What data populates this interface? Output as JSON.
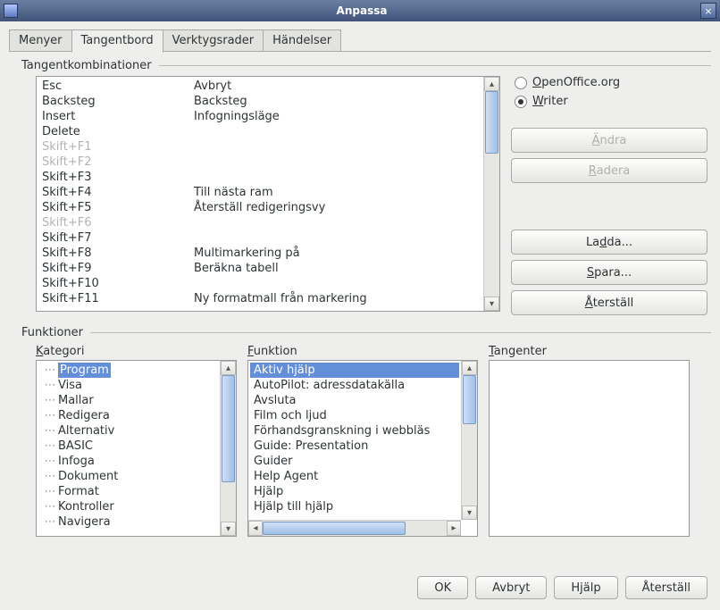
{
  "window": {
    "title": "Anpassa",
    "close_glyph": "×"
  },
  "tabs": {
    "menus": "Menyer",
    "keyboard": "Tangentbord",
    "toolbars": "Verktygsrader",
    "events": "Händelser"
  },
  "sections": {
    "shortcuts": "Tangentkombinationer",
    "functions": "Funktioner"
  },
  "shortcuts": [
    {
      "key": "Esc",
      "action": "Avbryt",
      "disabled": false
    },
    {
      "key": "Backsteg",
      "action": "Backsteg",
      "disabled": false
    },
    {
      "key": "Insert",
      "action": "Infogningsläge",
      "disabled": false
    },
    {
      "key": "Delete",
      "action": "",
      "disabled": false
    },
    {
      "key": "Skift+F1",
      "action": "",
      "disabled": true
    },
    {
      "key": "Skift+F2",
      "action": "",
      "disabled": true
    },
    {
      "key": "Skift+F3",
      "action": "",
      "disabled": false
    },
    {
      "key": "Skift+F4",
      "action": "Till nästa ram",
      "disabled": false
    },
    {
      "key": "Skift+F5",
      "action": "Återställ redigeringsvy",
      "disabled": false
    },
    {
      "key": "Skift+F6",
      "action": "",
      "disabled": true
    },
    {
      "key": "Skift+F7",
      "action": "",
      "disabled": false
    },
    {
      "key": "Skift+F8",
      "action": "Multimarkering på",
      "disabled": false
    },
    {
      "key": "Skift+F9",
      "action": "Beräkna tabell",
      "disabled": false
    },
    {
      "key": "Skift+F10",
      "action": "",
      "disabled": false
    },
    {
      "key": "Skift+F11",
      "action": "Ny formatmall från markering",
      "disabled": false
    }
  ],
  "scope": {
    "openoffice_html": "<span class='accel'>O</span>penOffice.org",
    "writer_html": "<span class='accel'>W</span>riter",
    "selected": "writer"
  },
  "buttons": {
    "modify_html": "<span class='accel'>Ä</span>ndra",
    "delete_html": "<span class='accel'>R</span>adera",
    "load_html": "La<span class='accel'>d</span>da...",
    "save_html": "<span class='accel'>S</span>para...",
    "reset_html": "<span class='accel'>Å</span>terställ"
  },
  "labels": {
    "category_html": "<span class='accel'>K</span>ategori",
    "function_html": "<span class='accel'>F</span>unktion",
    "keys_html": "<span class='accel'>T</span>angenter"
  },
  "categories": [
    "Program",
    "Visa",
    "Mallar",
    "Redigera",
    "Alternativ",
    "BASIC",
    "Infoga",
    "Dokument",
    "Format",
    "Kontroller",
    "Navigera"
  ],
  "functions": [
    "Aktiv hjälp",
    "AutoPilot: adressdatakälla",
    "Avsluta",
    "Film och ljud",
    "Förhandsgranskning i webbläs",
    "Guide: Presentation",
    "Guider",
    "Help Agent",
    "Hjälp",
    "Hjälp till hjälp"
  ],
  "bottom": {
    "ok": "OK",
    "cancel": "Avbryt",
    "help": "Hjälp",
    "reset": "Återställ"
  }
}
